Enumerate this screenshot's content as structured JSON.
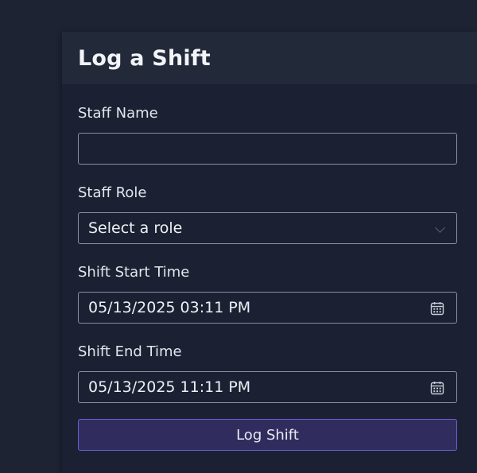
{
  "form": {
    "title": "Log a Shift",
    "staff_name": {
      "label": "Staff Name",
      "value": "",
      "placeholder": ""
    },
    "staff_role": {
      "label": "Staff Role",
      "selected": "Select a role"
    },
    "shift_start": {
      "label": "Shift Start Time",
      "value": "05/13/2025 03:11 PM",
      "icon": "calendar-icon"
    },
    "shift_end": {
      "label": "Shift End Time",
      "value": "05/13/2025 11:11 PM",
      "icon": "calendar-icon"
    },
    "submit_label": "Log Shift"
  },
  "colors": {
    "page_background": "#1d2333",
    "card_header": "#222939",
    "button_background": "#302d5e",
    "button_border": "#6a5fd0"
  }
}
